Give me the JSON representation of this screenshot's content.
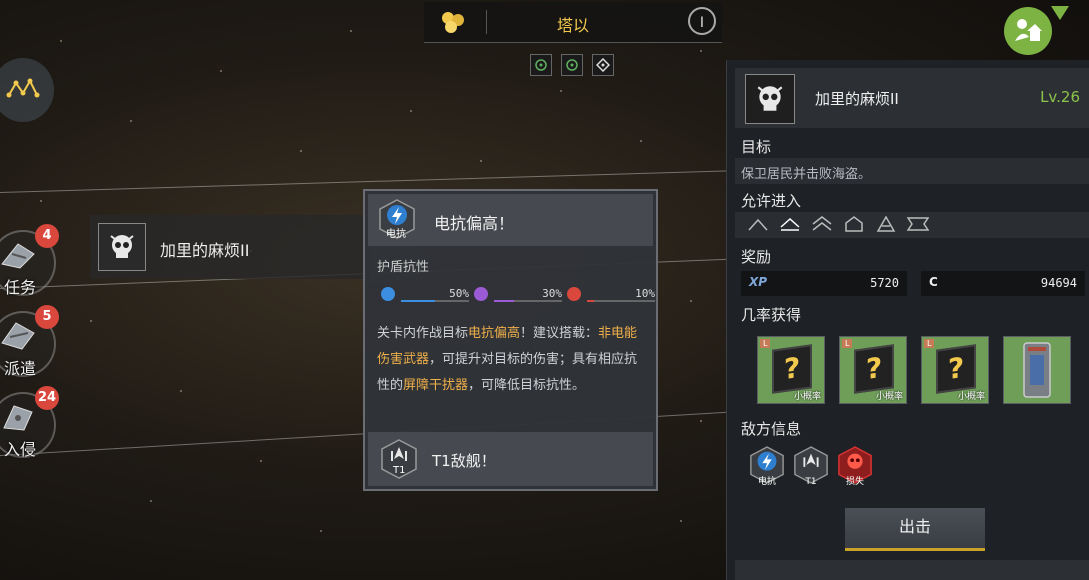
{
  "top_bar": {
    "location": "塔以",
    "info_icon": "I"
  },
  "side_menu": {
    "items": [
      {
        "label": "任务",
        "badge": "4"
      },
      {
        "label": "派遣",
        "badge": "5"
      },
      {
        "label": "入侵",
        "badge": "24"
      }
    ]
  },
  "mission_card": {
    "name": "加里的麻烦II"
  },
  "popup": {
    "header_title": "电抗偏高！",
    "header_icon_label": "电抗",
    "shield_title": "护盾抗性",
    "resistances": [
      {
        "type": "electric",
        "value": "50%",
        "fill": 0.5,
        "color": "#3b8ee0"
      },
      {
        "type": "kinetic",
        "value": "30%",
        "fill": 0.3,
        "color": "#9c5bd6"
      },
      {
        "type": "thermal",
        "value": "10%",
        "fill": 0.1,
        "color": "#d9473d"
      }
    ],
    "desc": {
      "p1": "关卡内作战目标",
      "h1": "电抗偏高",
      "p2": "！建议搭载：",
      "h2": "非电能伤害武器",
      "p3": "，可提升对目标的伤害；具有相应抗性的",
      "h3": "屏障干扰器",
      "p4": "，可降低目标抗性。"
    },
    "footer_title": "T1敌舰！",
    "footer_icon_label": "T1"
  },
  "panel": {
    "mission_name": "加里的麻烦II",
    "level": "Lv.26",
    "objective_title": "目标",
    "objective_text": "保卫居民并击败海盗。",
    "entry_title": "允许进入",
    "reward_title": "奖励",
    "rewards": [
      {
        "key": "XP",
        "value": "5720"
      },
      {
        "key": "C",
        "value": "94694"
      }
    ],
    "drops_title": "几率获得",
    "drops": [
      {
        "tag": "L",
        "note": "小概率"
      },
      {
        "tag": "L",
        "note": "小概率"
      },
      {
        "tag": "L",
        "note": "小概率"
      },
      {
        "tag": "",
        "note": ""
      }
    ],
    "enemy_title": "敌方信息",
    "enemy_tags": [
      "电抗",
      "T1",
      "损失"
    ],
    "go_button": "出击"
  },
  "colors": {
    "accent_green": "#7cb342",
    "highlight_orange": "#f0b04a",
    "level_green": "#8bc34a",
    "badge_red": "#d9473d"
  }
}
